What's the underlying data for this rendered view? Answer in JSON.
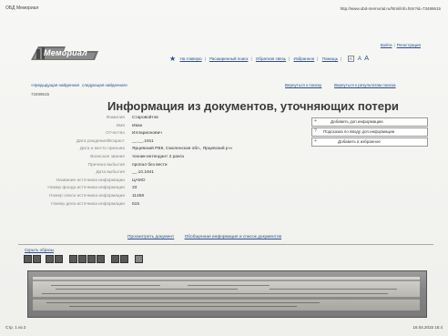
{
  "browser": {
    "title": "ОБД Мемориал",
    "url": "http://www.obd-memorial.ru/html/info.htm?id=73499615",
    "page_count": "Стр. 1 из 2",
    "datetime": "16.04.2015 15:4"
  },
  "site": {
    "logo_text": "Мемориал",
    "auth": {
      "login": "Войти",
      "register": "Регистрация"
    },
    "nav": [
      "На главную",
      "Расширенный поиск",
      "Обратная связь",
      "Избранное",
      "Помощь"
    ],
    "font_sizes": [
      "A",
      "A",
      "A"
    ]
  },
  "pager": {
    "prev": "«предыдущая найденная",
    "next": "следующая найденная»",
    "back_search": "Вернуться к поиску",
    "back_results": "Вернуться к результатам поиска"
  },
  "record_id": "73499615",
  "title": "Информация из документов, уточняющих потери",
  "fields": [
    {
      "label": "Фамилия",
      "value": "Старовойтов"
    },
    {
      "label": "Имя",
      "value": "Иван"
    },
    {
      "label": "Отчество",
      "value": "Илларионович"
    },
    {
      "label": "Дата рождения/Возраст",
      "value": "__.__.1911"
    },
    {
      "label": "Дата и место призыва",
      "value": "Ярцевский РВК, Смоленская обл., Ярцевский р-н"
    },
    {
      "label": "Воинское звание",
      "value": "техник-интендант 2 ранга"
    },
    {
      "label": "Причина выбытия",
      "value": "пропал без вести"
    },
    {
      "label": "Дата выбытия",
      "value": "__.10.1941"
    },
    {
      "label": "Название источника информации",
      "value": "ЦАМО"
    },
    {
      "label": "Номер фонда источника информации",
      "value": "33"
    },
    {
      "label": "Номер описи источника информации",
      "value": "11458"
    },
    {
      "label": "Номер дела источника информации",
      "value": "515"
    }
  ],
  "actions": [
    {
      "icon": "+",
      "label": "Добавить доп.информацию"
    },
    {
      "icon": "?",
      "label": "Подсказка по вводу доп.информации"
    },
    {
      "icon": "+",
      "label": "Добавить в избранное"
    }
  ],
  "links": {
    "view_doc": "Просмотреть документ",
    "generalized": "Обобщенная информация и список документов"
  },
  "viewer": {
    "hide": "Скрыть образы"
  }
}
